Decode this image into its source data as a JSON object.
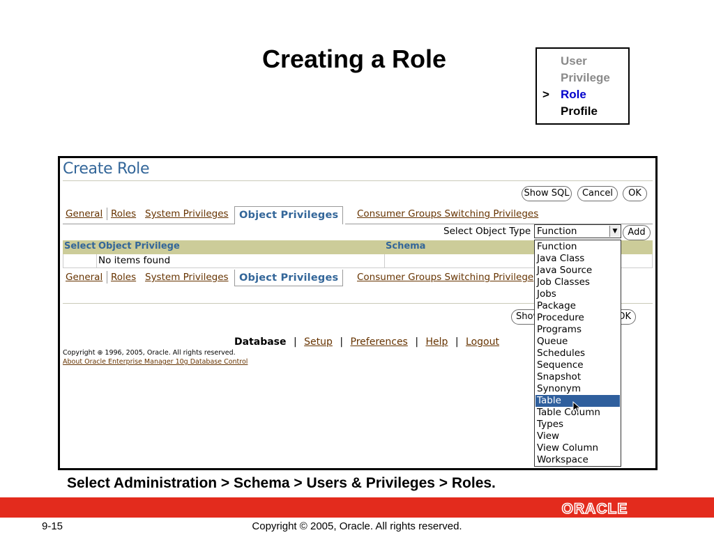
{
  "slide": {
    "title": "Creating a Role",
    "caption": "Select Administration > Schema > Users & Privileges > Roles.",
    "number": "9-15",
    "copyright": "Copyright © 2005, Oracle.  All rights reserved.",
    "logo_text": "ORACLE",
    "accent_color": "#e32b1d"
  },
  "nav_box": {
    "marker": ">",
    "items": [
      {
        "label": "User",
        "state": "dim"
      },
      {
        "label": "Privilege",
        "state": "dim"
      },
      {
        "label": "Role",
        "state": "active"
      },
      {
        "label": "Profile",
        "state": "plain"
      }
    ]
  },
  "em": {
    "heading": "Create Role",
    "buttons": {
      "show_sql": "Show SQL",
      "cancel": "Cancel",
      "ok": "OK",
      "add": "Add",
      "show_partial": "Show",
      "ok_partial": "OK"
    },
    "tabs": {
      "general": "General",
      "roles": "Roles",
      "system_privileges": "System Privileges",
      "object_privileges": "Object Privileges",
      "consumer_groups": "Consumer Groups Switching Privileges",
      "consumer_groups_partial": "Consumer Groups Switching Privilege"
    },
    "select_object_type": {
      "label": "Select Object Type",
      "value": "Function",
      "options": [
        "Function",
        "Java Class",
        "Java Source",
        "Job Classes",
        "Jobs",
        "Package",
        "Procedure",
        "Programs",
        "Queue",
        "Schedules",
        "Sequence",
        "Snapshot",
        "Synonym",
        "Table",
        "Table Column",
        "Types",
        "View",
        "View Column",
        "Workspace"
      ],
      "highlighted": "Table"
    },
    "grid": {
      "columns": [
        "Select",
        "Object Privilege",
        "Schema"
      ],
      "empty_text": "No items found"
    },
    "footer": {
      "database": "Database",
      "links": [
        "Setup",
        "Preferences",
        "Help",
        "Logout"
      ],
      "copyright": "Copyright ⊕ 1996, 2005, Oracle. All rights reserved.",
      "about": "About Oracle Enterprise Manager 10g Database Control"
    }
  }
}
